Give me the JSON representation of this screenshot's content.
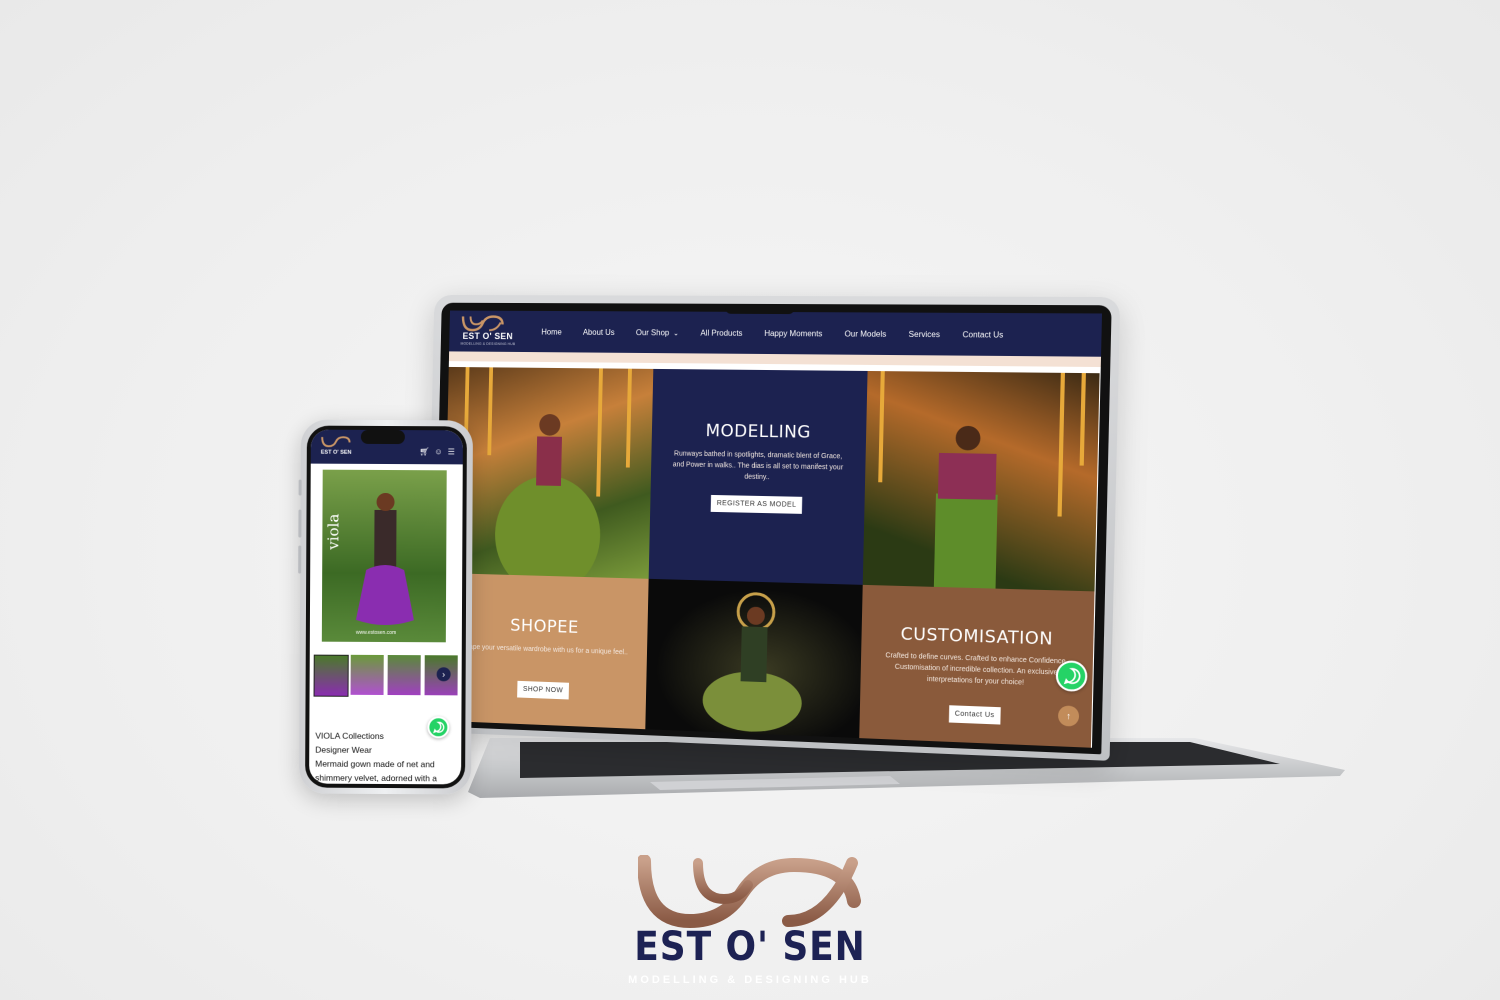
{
  "brand": {
    "name": "EST O' SEN",
    "tagline": "MODELLING & DESIGNING HUB",
    "colors": {
      "navy": "#1c2250",
      "bronze": "#a67255",
      "tan": "#c99566",
      "brown": "#8a5a3b"
    }
  },
  "laptop": {
    "nav": {
      "items": [
        {
          "label": "Home"
        },
        {
          "label": "About Us"
        },
        {
          "label": "Our Shop",
          "has_dropdown": true,
          "dropdown_icon": "chevron-down-icon"
        },
        {
          "label": "All Products"
        },
        {
          "label": "Happy Moments"
        },
        {
          "label": "Our Models"
        },
        {
          "label": "Services"
        },
        {
          "label": "Contact Us"
        }
      ]
    },
    "tiles": {
      "modelling": {
        "title": "MODELLING",
        "text": "Runways bathed in spotlights, dramatic blent of Grace, and Power in walks.. The dias is all set to manifest your destiny..",
        "button": "REGISTER AS MODEL"
      },
      "shopee": {
        "title": "SHOPEE",
        "text": "Shape your versatile wardrobe with us for a unique feel..",
        "button": "SHOP NOW"
      },
      "customisation": {
        "title": "CUSTOMISATION",
        "text": "Crafted to define curves. Crafted to enhance Confidence. Customisation of incredible collection. An exclusive interpretations for your choice!",
        "button": "Contact Us"
      }
    },
    "widgets": {
      "whatsapp_icon": "whatsapp-icon",
      "back_to_top_icon": "arrow-up-icon"
    }
  },
  "phone": {
    "brand": "EST O' SEN",
    "header_icons": [
      "cart-icon",
      "user-icon",
      "menu-icon"
    ],
    "product_image_label": "viola",
    "product_image_caption": "www.estosen.com",
    "product": {
      "collection": "VIOLA Collections",
      "category": "Designer Wear",
      "desc_line1": "Mermaid gown made of net and",
      "desc_line2": "shimmery velvet, adorned with a"
    }
  }
}
